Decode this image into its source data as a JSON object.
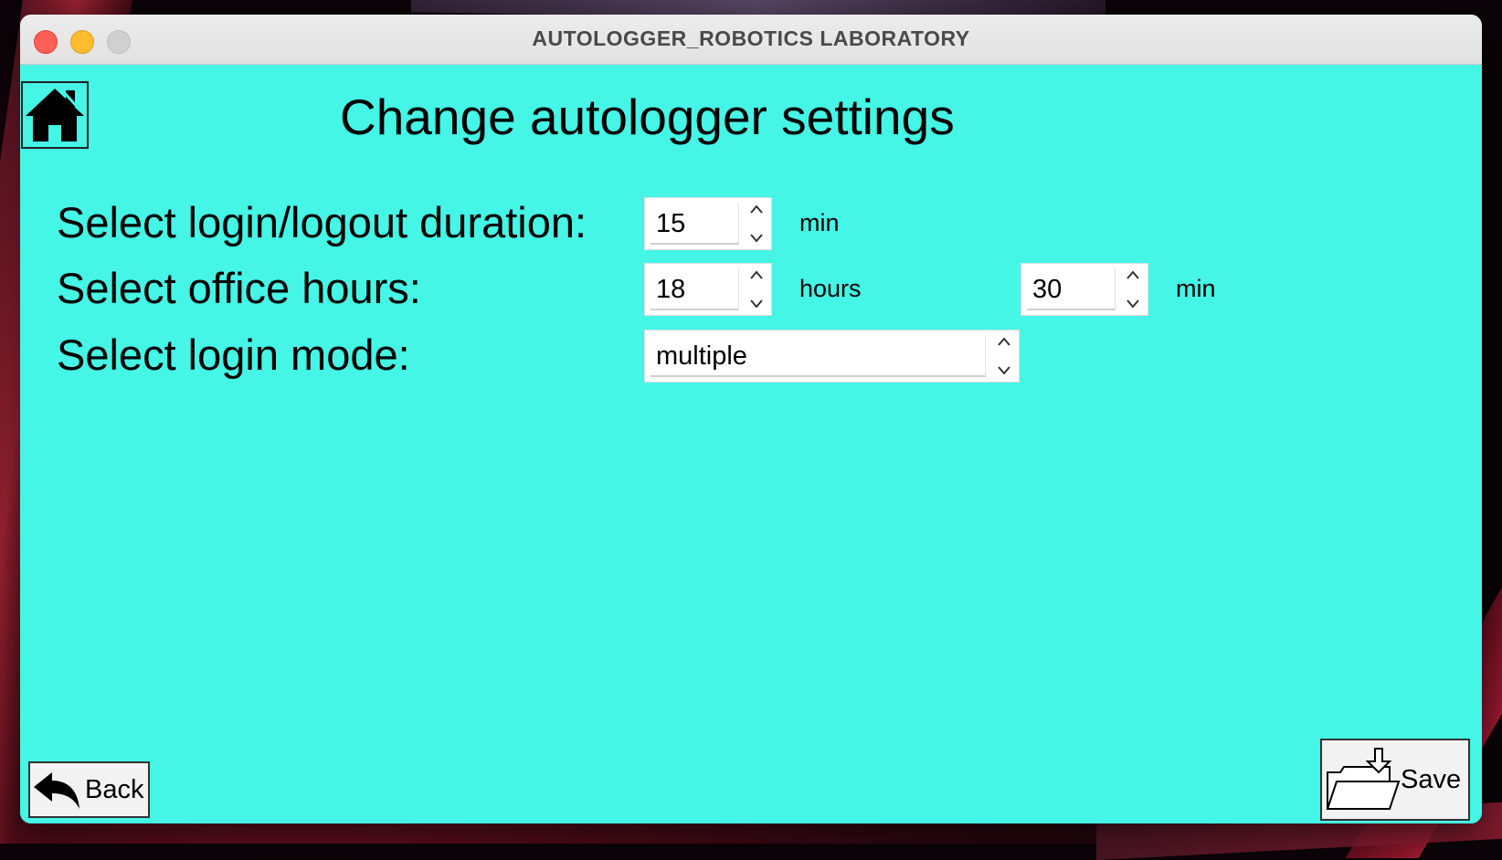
{
  "window": {
    "title": "AUTOLOGGER_ROBOTICS LABORATORY"
  },
  "page": {
    "title": "Change autologger settings"
  },
  "rows": {
    "duration": {
      "label": "Select login/logout duration:",
      "value": "15",
      "unit": "min"
    },
    "office_hours": {
      "label": "Select office hours:",
      "hours_value": "18",
      "hours_unit": "hours",
      "min_value": "30",
      "min_unit": "min"
    },
    "login_mode": {
      "label": "Select login mode:",
      "value": "multiple"
    }
  },
  "buttons": {
    "back": "Back",
    "save": "Save"
  },
  "icons": {
    "home": "home-icon",
    "back": "back-arrow-icon",
    "save": "folder-save-icon",
    "spin_up": "chevron-up-icon",
    "spin_down": "chevron-down-icon"
  },
  "colors": {
    "background": "#45f5e6",
    "button_bg": "#f2f2f2"
  }
}
